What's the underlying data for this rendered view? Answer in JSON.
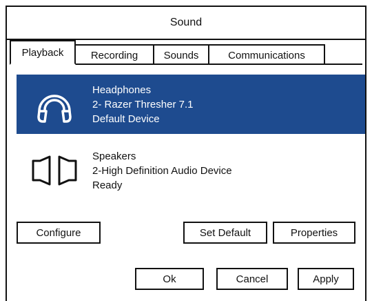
{
  "window": {
    "title": "Sound"
  },
  "tabs": [
    {
      "label": "Playback"
    },
    {
      "label": "Recording"
    },
    {
      "label": "Sounds"
    },
    {
      "label": "Communications"
    }
  ],
  "devices": [
    {
      "name": "Headphones",
      "detail": "2- Razer Thresher 7.1",
      "status": "Default Device",
      "icon": "headphones-icon",
      "selected": true
    },
    {
      "name": "Speakers",
      "detail": "2-High Definition Audio Device",
      "status": "Ready",
      "icon": "speakers-icon",
      "selected": false
    }
  ],
  "buttons": {
    "configure": "Configure",
    "set_default": "Set Default",
    "properties": "Properties",
    "ok": "Ok",
    "cancel": "Cancel",
    "apply": "Apply"
  },
  "colors": {
    "selection": "#1e4b8f"
  }
}
